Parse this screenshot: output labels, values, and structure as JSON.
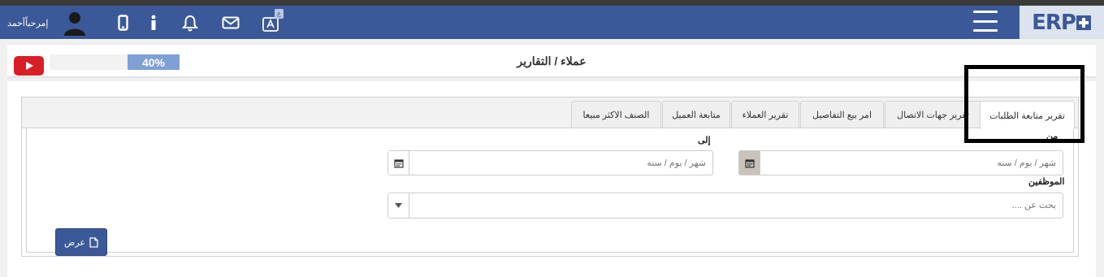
{
  "navbar": {
    "logo_text": "ERP",
    "user_greeting": "إمرحباًأحمد",
    "translate_badge": "ع",
    "icons": [
      "user-avatar-icon",
      "mobile-icon",
      "info-icon",
      "bell-icon",
      "mail-icon",
      "translate-icon",
      "menu-icon"
    ]
  },
  "header": {
    "progress_label": "40%",
    "progress_value": 0.4,
    "title": "عملاء / التقارير"
  },
  "tabs": [
    {
      "label": "تقرير متابعة الطلبات",
      "active": true
    },
    {
      "label": "تقرير جهات الاتصال",
      "active": false
    },
    {
      "label": "امر بيع التفاصيل",
      "active": false
    },
    {
      "label": "تقرير العملاء",
      "active": false
    },
    {
      "label": "متابعة العميل",
      "active": false
    },
    {
      "label": "الصنف الاكثر مبيعا",
      "active": false
    }
  ],
  "form": {
    "from_label": "من",
    "to_label": "إلى",
    "date_placeholder": "شهر / يوم / سنه",
    "employees_label": "الموظفين",
    "search_placeholder": "بحث عن ....",
    "view_button": "عرض"
  },
  "colors": {
    "navbar": "#3b5998",
    "progress": "#7f9fd6",
    "youtube": "#d81f26"
  }
}
